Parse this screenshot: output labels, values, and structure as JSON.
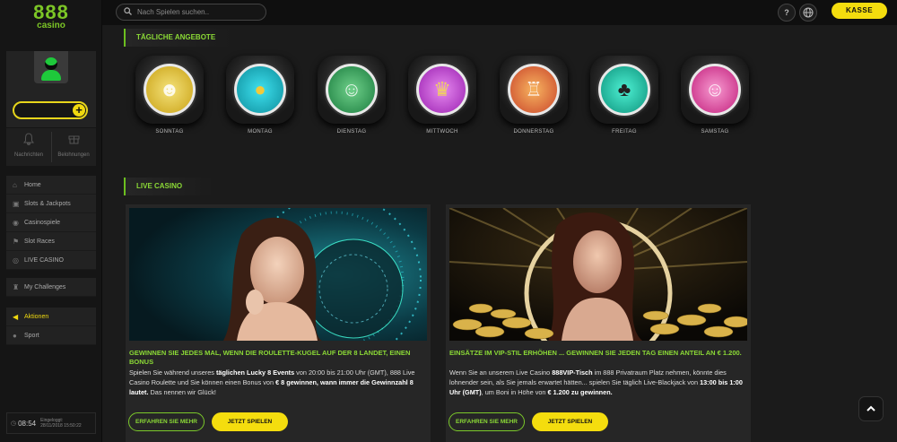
{
  "logo": {
    "number": "888",
    "word": "casino"
  },
  "sidebar": {
    "notifications_label": "Nachrichten",
    "rewards_label": "Belohnungen",
    "nav_main": [
      {
        "label": "Home",
        "icon": "home-icon"
      },
      {
        "label": "Slots & Jackpots",
        "icon": "slot-icon"
      },
      {
        "label": "Casinospiele",
        "icon": "chip-icon"
      },
      {
        "label": "Slot Races",
        "icon": "flag-icon"
      },
      {
        "label": "LIVE CASINO",
        "icon": "live-icon"
      }
    ],
    "challenges_label": "My Challenges",
    "promotions_label": "Aktionen",
    "sport_label": "Sport",
    "clock_time": "08:54",
    "login_label": "Eingeloggt:",
    "login_time": "28/11/2018 15:50:22"
  },
  "topbar": {
    "search_placeholder": "Nach Spielen suchen..",
    "help_label": "?",
    "cashier_label": "KASSE"
  },
  "daily": {
    "heading": "TÄGLICHE ANGEBOTE",
    "days": [
      {
        "label": "SONNTAG",
        "color": "#d9b91a"
      },
      {
        "label": "MONTAG",
        "color": "#16b7c8"
      },
      {
        "label": "DIENSTAG",
        "color": "#2aa85a"
      },
      {
        "label": "MITTWOCH",
        "color": "#c23bd6"
      },
      {
        "label": "DONNERSTAG",
        "color": "#e8742a"
      },
      {
        "label": "FREITAG",
        "color": "#15c1a3"
      },
      {
        "label": "SAMSTAG",
        "color": "#e04aa8"
      }
    ]
  },
  "live": {
    "heading": "LIVE CASINO",
    "card1": {
      "title": "GEWINNEN SIE JEDES MAL, WENN DIE ROULETTE-KUGEL AUF DER 8 LANDET, EINEN BONUS",
      "text_1": "Spielen Sie während unseres ",
      "text_2": "täglichen Lucky 8 Events",
      "text_3": " von 20:00 bis 21:00 Uhr (GMT), 888 Live Casino Roulette und Sie können einen Bonus von ",
      "text_4": "€ 8 gewinnen, wann immer die Gewinnzahl 8 lautet.",
      "text_5": " Das nennen wir Glück!",
      "more_label": "ERFAHREN SIE MEHR",
      "play_label": "JETZT SPIELEN"
    },
    "card2": {
      "title": "EINSÄTZE IM VIP-STIL ERHÖHEN ... GEWINNEN SIE JEDEN TAG EINEN ANTEIL AN € 1.200.",
      "text_1": "Wenn Sie an unserem Live Casino ",
      "text_2": "888VIP-Tisch",
      "text_3": " im 888 Privatraum Platz nehmen, könnte dies lohnender sein, als Sie jemals erwartet hätten... spielen Sie täglich Live-Blackjack von ",
      "text_4": "13:00 bis 1:00 Uhr (GMT)",
      "text_5": ", um Boni in Höhe von ",
      "text_6": "€ 1.200 zu gewinnen.",
      "more_label": "ERFAHREN SIE MEHR",
      "play_label": "JETZT SPIELEN"
    }
  },
  "scroll_top_icon": "chevron-up-icon"
}
